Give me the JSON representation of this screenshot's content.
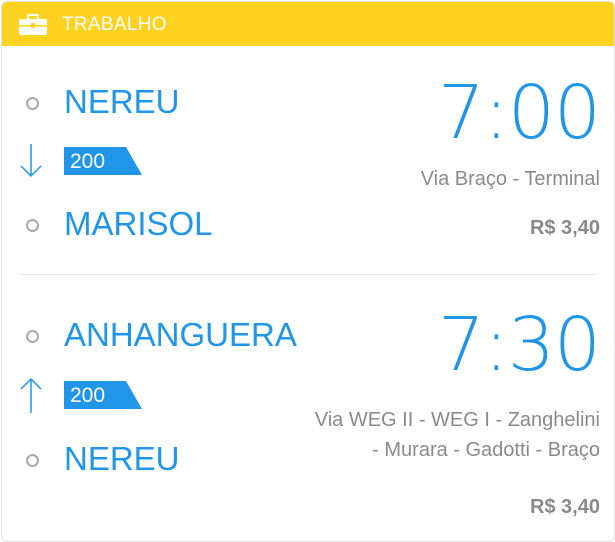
{
  "header": {
    "title": "TRABALHO",
    "icon": "briefcase-icon",
    "color": "#ffd21f"
  },
  "trips": [
    {
      "origin": "NEREU",
      "destination": "MARISOL",
      "line": "200",
      "direction_icon": "arrow-down-icon",
      "time": "7:00",
      "route": [
        "Via Braço - Terminal"
      ],
      "price": "R$ 3,40"
    },
    {
      "origin": "ANHANGUERA",
      "destination": "NEREU",
      "line": "200",
      "direction_icon": "arrow-up-icon",
      "time": "7:30",
      "route": [
        "Via WEG II - WEG I - Zanghelini",
        "- Murara - Gadotti - Braço"
      ],
      "price": "R$ 3,40"
    }
  ],
  "colors": {
    "accent": "#2196e8",
    "muted": "#8a8a8a"
  }
}
